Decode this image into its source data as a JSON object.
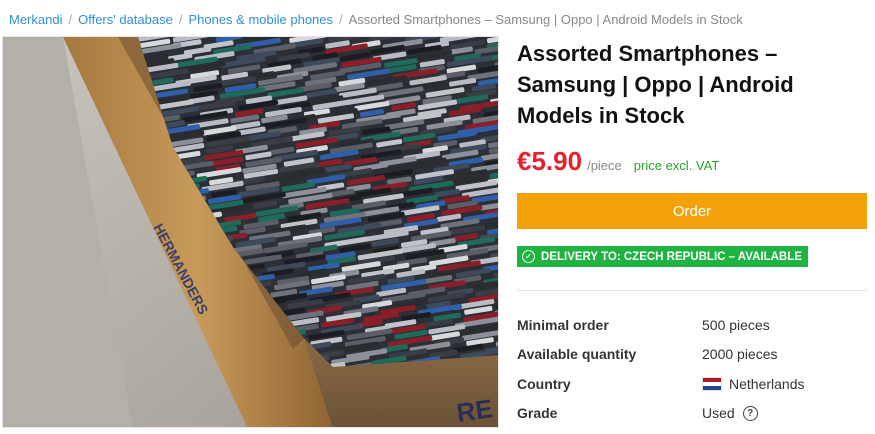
{
  "breadcrumb": {
    "items": [
      "Merkandi",
      "Offers' database",
      "Phones & mobile phones"
    ],
    "current": "Assorted Smartphones – Samsung | Oppo | Android Models in Stock"
  },
  "product": {
    "title": "Assorted Smartphones – Samsung | Oppo | Android Models in Stock",
    "price": "€5.90",
    "unit": "/piece",
    "vat_note": "price excl. VAT",
    "order_label": "Order",
    "delivery_text": "DELIVERY TO: CZECH REPUBLIC – AVAILABLE",
    "image_text": "HERMANDERS",
    "image_text_2": "RE"
  },
  "specs": [
    {
      "label": "Minimal order",
      "value": "500 pieces"
    },
    {
      "label": "Available quantity",
      "value": "2000 pieces"
    },
    {
      "label": "Country",
      "value": "Netherlands"
    },
    {
      "label": "Grade",
      "value": "Used"
    }
  ],
  "colors": {
    "price": "#e8202a",
    "vat": "#27a327",
    "order_button": "#f4a20c",
    "delivery_badge": "#1fb341",
    "link": "#2f8fd8",
    "flag_red": "#ae1c28",
    "flag_white": "#ffffff",
    "flag_blue": "#21468b"
  },
  "icons": {
    "delivery": "check-circle-icon",
    "country": "netherlands-flag-icon",
    "grade": "question-circle-icon"
  }
}
